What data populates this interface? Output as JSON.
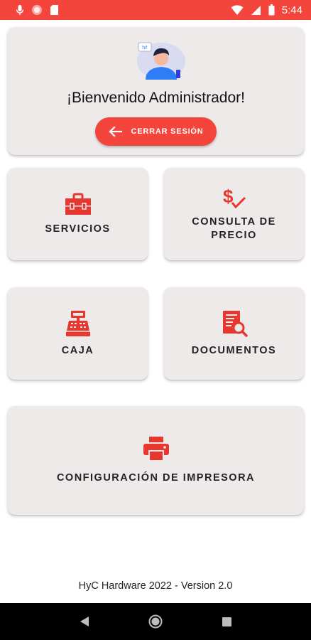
{
  "status_bar": {
    "time": "5:44",
    "background": "#f4453c",
    "left_icons": [
      "microphone-icon",
      "record-icon",
      "sd-card-icon"
    ],
    "right_icons": [
      "wifi-icon",
      "signal-icon",
      "battery-icon"
    ]
  },
  "welcome": {
    "greeting": "¡Bienvenido Administrador!",
    "avatar_bubble_text": "hi!",
    "logout_label": "CERRAR SESIÓN",
    "logout_icon": "arrow-left-icon"
  },
  "menu": {
    "servicios": {
      "label": "SERVICIOS",
      "icon": "toolbox-icon"
    },
    "consulta_precio": {
      "label": "CONSULTA DE\nPRECIO",
      "icon": "dollar-check-icon"
    },
    "caja": {
      "label": "CAJA",
      "icon": "cash-register-icon"
    },
    "documentos": {
      "label": "DOCUMENTOS",
      "icon": "document-search-icon"
    },
    "impresora": {
      "label": "CONFIGURACIÓN DE IMPRESORA",
      "icon": "printer-icon"
    }
  },
  "footer": {
    "text": "HyC Hardware 2022 - Version 2.0"
  },
  "nav_bar": {
    "buttons": [
      "back-icon",
      "home-icon",
      "recents-icon"
    ]
  },
  "colors": {
    "accent": "#f4453c",
    "card": "#eeeaea",
    "icon_red": "#e8372f"
  }
}
